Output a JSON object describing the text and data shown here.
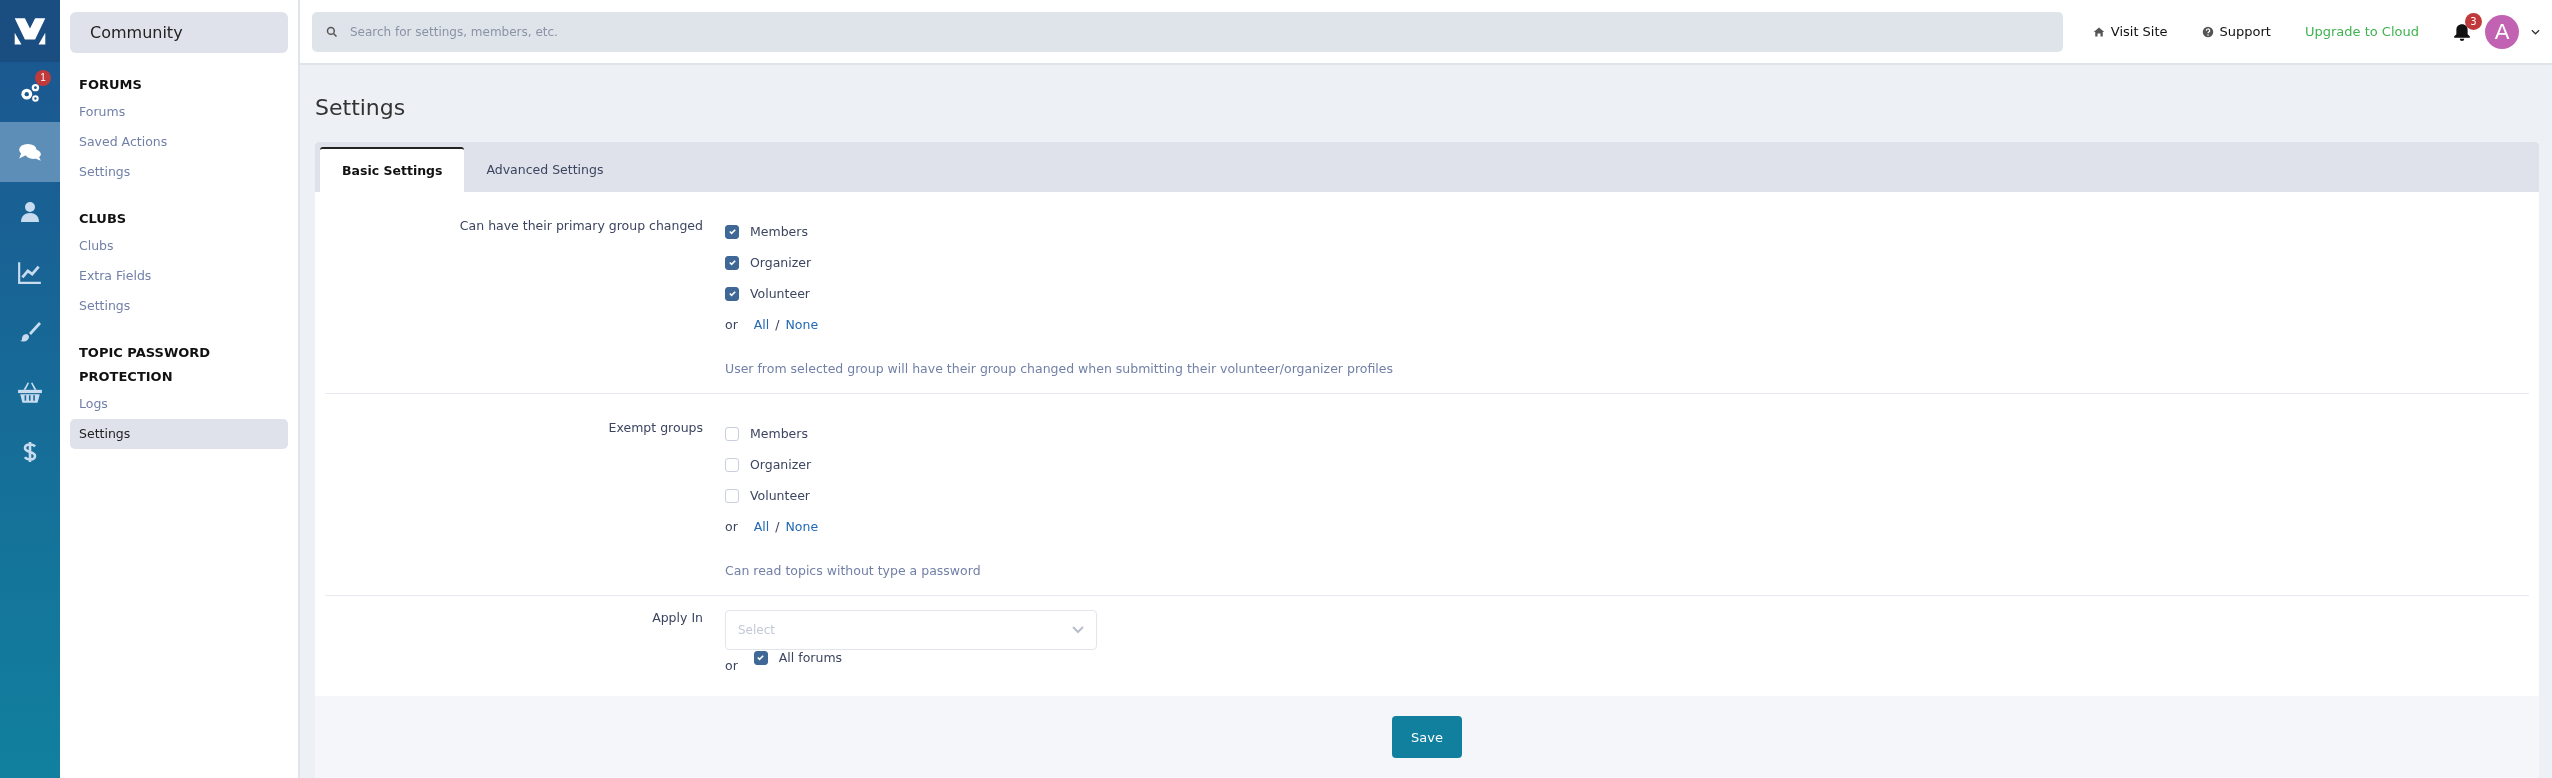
{
  "rail": {
    "items": [
      {
        "kind": "gears",
        "selected": false,
        "badge": "1"
      },
      {
        "kind": "chat",
        "selected": true
      },
      {
        "kind": "user",
        "selected": false
      },
      {
        "kind": "chart",
        "selected": false
      },
      {
        "kind": "brush",
        "selected": false
      },
      {
        "kind": "basket",
        "selected": false
      },
      {
        "kind": "dollar",
        "selected": false
      }
    ]
  },
  "sidebar": {
    "title": "Community",
    "sections": [
      {
        "heading": "FORUMS",
        "items": [
          {
            "label": "Forums",
            "selected": false
          },
          {
            "label": "Saved Actions",
            "selected": false
          },
          {
            "label": "Settings",
            "selected": false
          }
        ]
      },
      {
        "heading": "CLUBS",
        "items": [
          {
            "label": "Clubs",
            "selected": false
          },
          {
            "label": "Extra Fields",
            "selected": false
          },
          {
            "label": "Settings",
            "selected": false
          }
        ]
      },
      {
        "heading": "TOPIC PASSWORD PROTECTION",
        "items": [
          {
            "label": "Logs",
            "selected": false
          },
          {
            "label": "Settings",
            "selected": true
          }
        ]
      }
    ]
  },
  "topbar": {
    "search": {
      "placeholder": "Search for settings, members, etc."
    },
    "links": [
      {
        "kind": "home",
        "label": "Visit Site"
      },
      {
        "kind": "help",
        "label": "Support"
      },
      {
        "kind": "upgrade",
        "label": "Upgrade to Cloud"
      }
    ],
    "notifications": {
      "count": "3"
    },
    "avatar": {
      "letter": "A"
    }
  },
  "page": {
    "title": "Settings"
  },
  "tabs": [
    {
      "label": "Basic Settings",
      "selected": true
    },
    {
      "label": "Advanced Settings",
      "selected": false
    }
  ],
  "settings": [
    {
      "kind": "checklist",
      "label": "Can have their primary group changed",
      "options": [
        {
          "label": "Members",
          "checked": true
        },
        {
          "label": "Organizer",
          "checked": true
        },
        {
          "label": "Volunteer",
          "checked": true
        }
      ],
      "or": "or",
      "all": "All",
      "separator": "/",
      "none": "None",
      "help": "User from selected group will have their group changed when submitting their volunteer/organizer profiles"
    },
    {
      "kind": "checklist",
      "label": "Exempt groups",
      "options": [
        {
          "label": "Members",
          "checked": false
        },
        {
          "label": "Organizer",
          "checked": false
        },
        {
          "label": "Volunteer",
          "checked": false
        }
      ],
      "or": "or",
      "all": "All",
      "separator": "/",
      "none": "None",
      "help": "Can read topics without type a password"
    },
    {
      "kind": "select",
      "label": "Apply In",
      "placeholder": "Select",
      "or": "or",
      "option": {
        "label": "All forums",
        "checked": true
      }
    }
  ],
  "save": "Save"
}
